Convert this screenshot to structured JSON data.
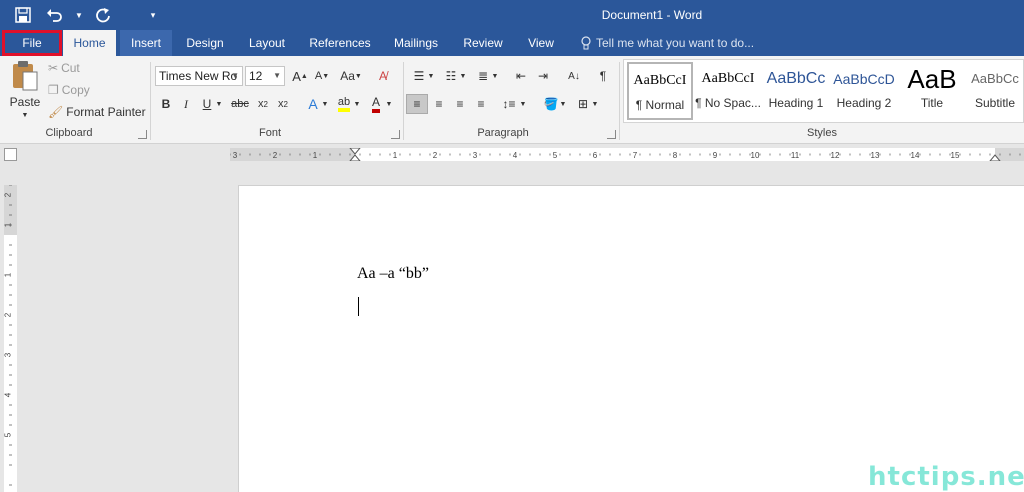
{
  "window": {
    "title": "Document1 - Word"
  },
  "qat": {
    "save_icon": "save-icon",
    "undo_icon": "undo-icon",
    "redo_icon": "repeat-icon",
    "customize_icon": "customize-icon"
  },
  "tabs": [
    "File",
    "Home",
    "Insert",
    "Design",
    "Layout",
    "References",
    "Mailings",
    "Review",
    "View"
  ],
  "tell_me": "Tell me what you want to do...",
  "clipboard": {
    "paste": "Paste",
    "cut": "Cut",
    "copy": "Copy",
    "format_painter": "Format Painter",
    "label": "Clipboard"
  },
  "font": {
    "name": "Times New Ro",
    "size": "12",
    "label": "Font",
    "change_case": "Aa"
  },
  "paragraph": {
    "label": "Paragraph"
  },
  "styles": {
    "label": "Styles",
    "items": [
      {
        "preview": "AaBbCcI",
        "name": "¶ Normal"
      },
      {
        "preview": "AaBbCcI",
        "name": "¶ No Spac..."
      },
      {
        "preview": "AaBbCc",
        "name": "Heading 1"
      },
      {
        "preview": "AaBbCcD",
        "name": "Heading 2"
      },
      {
        "preview": "AaB",
        "name": "Title"
      },
      {
        "preview": "AaBbCc",
        "name": "Subtitle"
      }
    ]
  },
  "ruler": {
    "h_labels": [
      "3",
      "2",
      "1",
      "1",
      "2",
      "3",
      "4",
      "5",
      "6",
      "7",
      "8",
      "9",
      "10",
      "11",
      "12",
      "13",
      "14",
      "15"
    ],
    "v_labels": [
      "2",
      "1",
      "1",
      "2",
      "3",
      "4",
      "5"
    ]
  },
  "document": {
    "text": "Aa –a “bb”"
  },
  "watermark": "htctips.net",
  "colors": {
    "accent": "#2b579a",
    "file_highlight": "#e0102a",
    "font_color": "#c00000",
    "highlight": "#ffff00"
  }
}
